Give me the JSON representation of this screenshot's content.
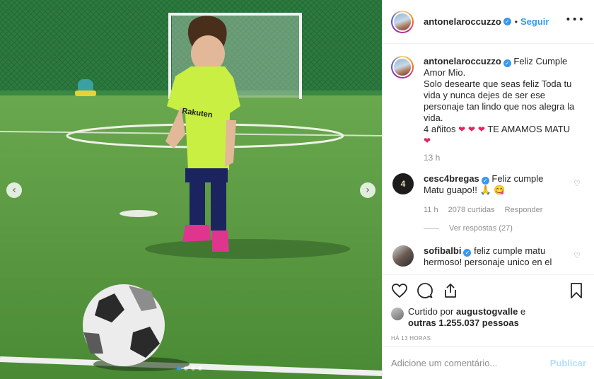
{
  "post": {
    "username": "antonelaroccuzzo",
    "follow_label": "Seguir",
    "header_separator": "•",
    "more_icon": "ellipsis-icon",
    "caption": {
      "username": "antonelaroccuzzo",
      "text": "Feliz Cumple Amor Mio.\nSolo desearte que seas feliz Toda tu vida y nunca dejes de ser ese personaje tan lindo que nos alegra la vida.\n4 añitos",
      "hearts": "❤ ❤ ❤",
      "text_after_hearts": "TE AMAMOS MATU",
      "final_heart": "❤",
      "time": "13 h"
    },
    "comments": [
      {
        "username": "cesc4bregas",
        "avatar_text": "4",
        "text": "Feliz cumple Matu guapo!! 🙏 😋",
        "time": "11 h",
        "likes": "2078 curtidas",
        "reply_label": "Responder",
        "view_replies": "Ver respostas (27)"
      },
      {
        "username": "sofibalbi",
        "text": "feliz cumple matu hermoso! personaje unico en el"
      }
    ],
    "likes": {
      "prefix": "Curtido por",
      "user": "augustogvalle",
      "conjunction": "e",
      "others": "outras 1.255.037 pessoas"
    },
    "timestamp": "HÁ 13 HORAS",
    "add_comment_placeholder": "Adicione um comentário...",
    "publish_label": "Publicar",
    "carousel": {
      "count": 4,
      "active_index": 0
    },
    "colors": {
      "accent": "#3897f0",
      "heart": "#e0245e",
      "publish_disabled": "#b2dffc",
      "muted": "#8e8e8e"
    }
  }
}
